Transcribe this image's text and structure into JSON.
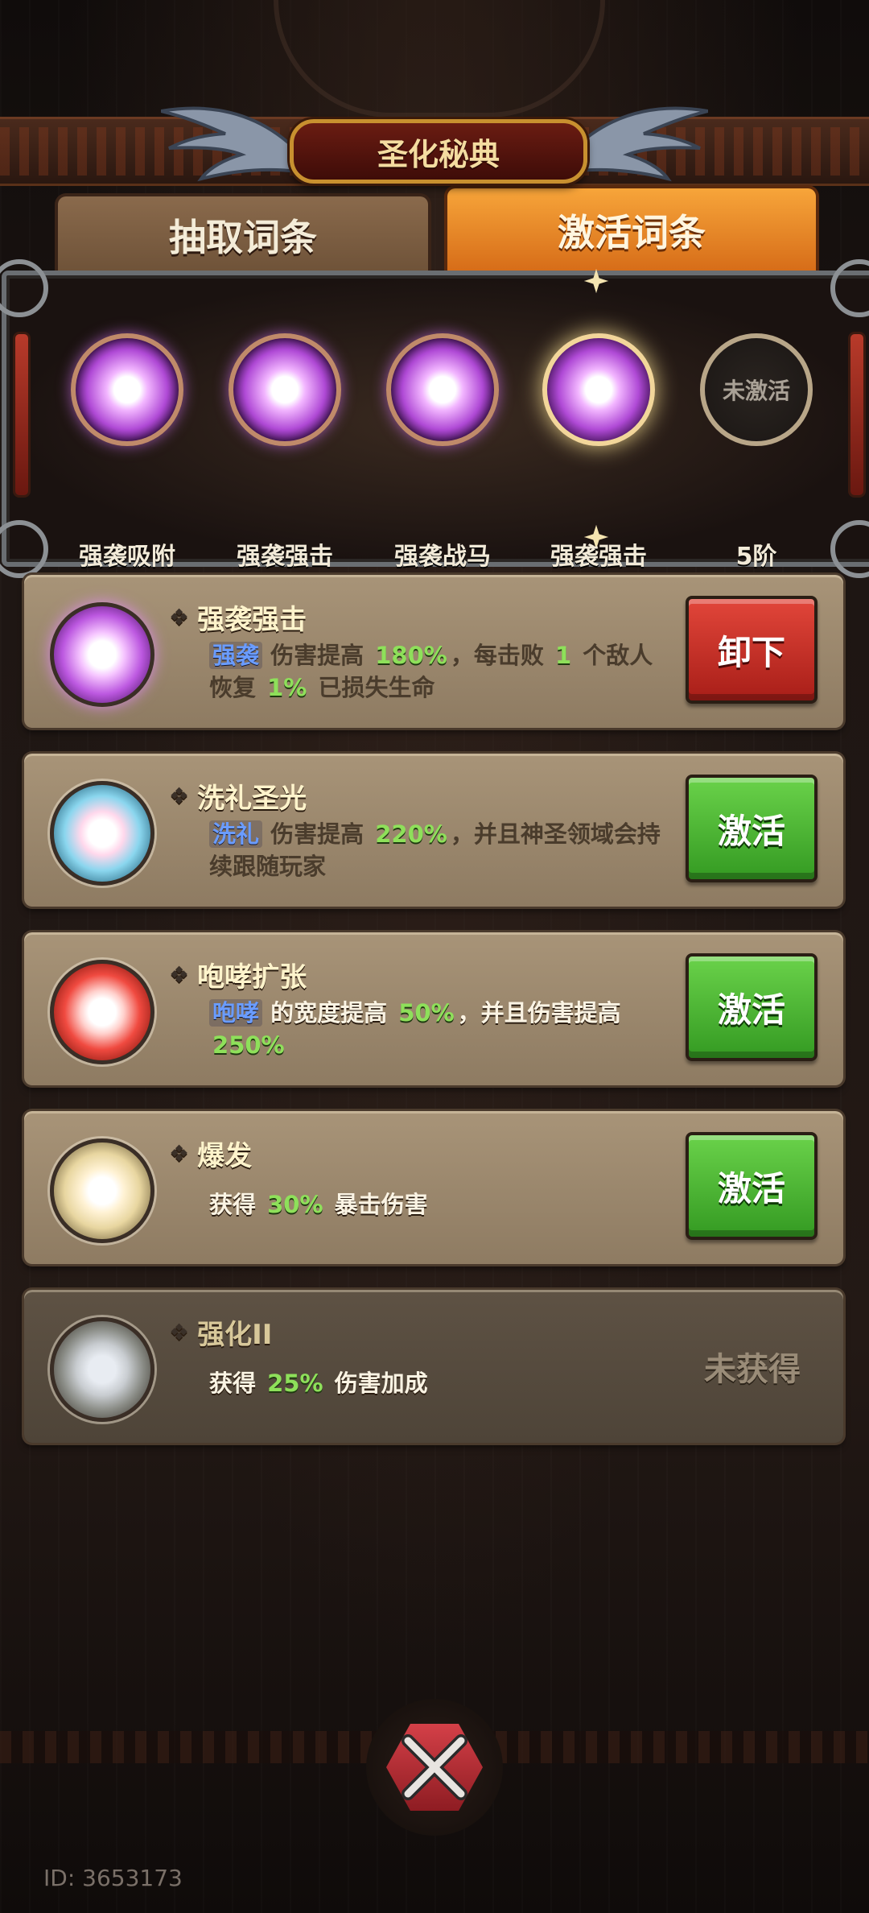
{
  "title": "圣化秘典",
  "tabs": [
    {
      "label": "抽取词条",
      "active": false
    },
    {
      "label": "激活词条",
      "active": true
    }
  ],
  "slots": [
    {
      "label": "强袭吸附",
      "state": "filled"
    },
    {
      "label": "强袭强击",
      "state": "filled"
    },
    {
      "label": "强袭战马",
      "state": "filled"
    },
    {
      "label": "强袭强击",
      "state": "selected"
    },
    {
      "label": "5阶",
      "state": "empty",
      "empty_text": "未激活"
    }
  ],
  "cards": [
    {
      "name": "强袭强击",
      "orb": "purple",
      "desc": {
        "kw": "强袭",
        "t1": "伤害提高",
        "n1": "180%",
        "t2": "，每击败",
        "n2": "1",
        "t3": "个敌人恢复",
        "n3": "1%",
        "t4": "已损失生命"
      },
      "button": "卸下",
      "button_color": "#c8302a"
    },
    {
      "name": "洗礼圣光",
      "orb": "cyan",
      "desc": {
        "kw": "洗礼",
        "t1": "伤害提高",
        "n1": "220%",
        "t2": "，并且神圣领域会持续跟随玩家"
      },
      "button": "激活",
      "button_color": "#4cb634"
    },
    {
      "name": "咆哮扩张",
      "orb": "red",
      "desc": {
        "kw": "咆哮",
        "t1": "的宽度提高",
        "n1": "50%",
        "t2": "，并且伤害提高",
        "n2": "250%"
      },
      "button": "激活",
      "button_color": "#4cb634"
    },
    {
      "name": "爆发",
      "orb": "gold",
      "desc": {
        "t1": "获得",
        "n1": "30%",
        "t2": "暴击伤害"
      },
      "button": "激活",
      "button_color": "#4cb634"
    },
    {
      "name": "强化II",
      "orb": "gray",
      "desc": {
        "t1": "获得",
        "n1": "25%",
        "t2": "伤害加成"
      },
      "status": "未获得"
    }
  ],
  "id_label": "ID: 3653173",
  "icons": {
    "close": "close-x-icon",
    "wing": "wing-icon",
    "diamond": "diamond-bullet-icon"
  },
  "colors": {
    "tab_active": "#e88a28",
    "title_border": "#c8902f",
    "keyword": "#6a9cff",
    "number": "#8ee05a"
  }
}
